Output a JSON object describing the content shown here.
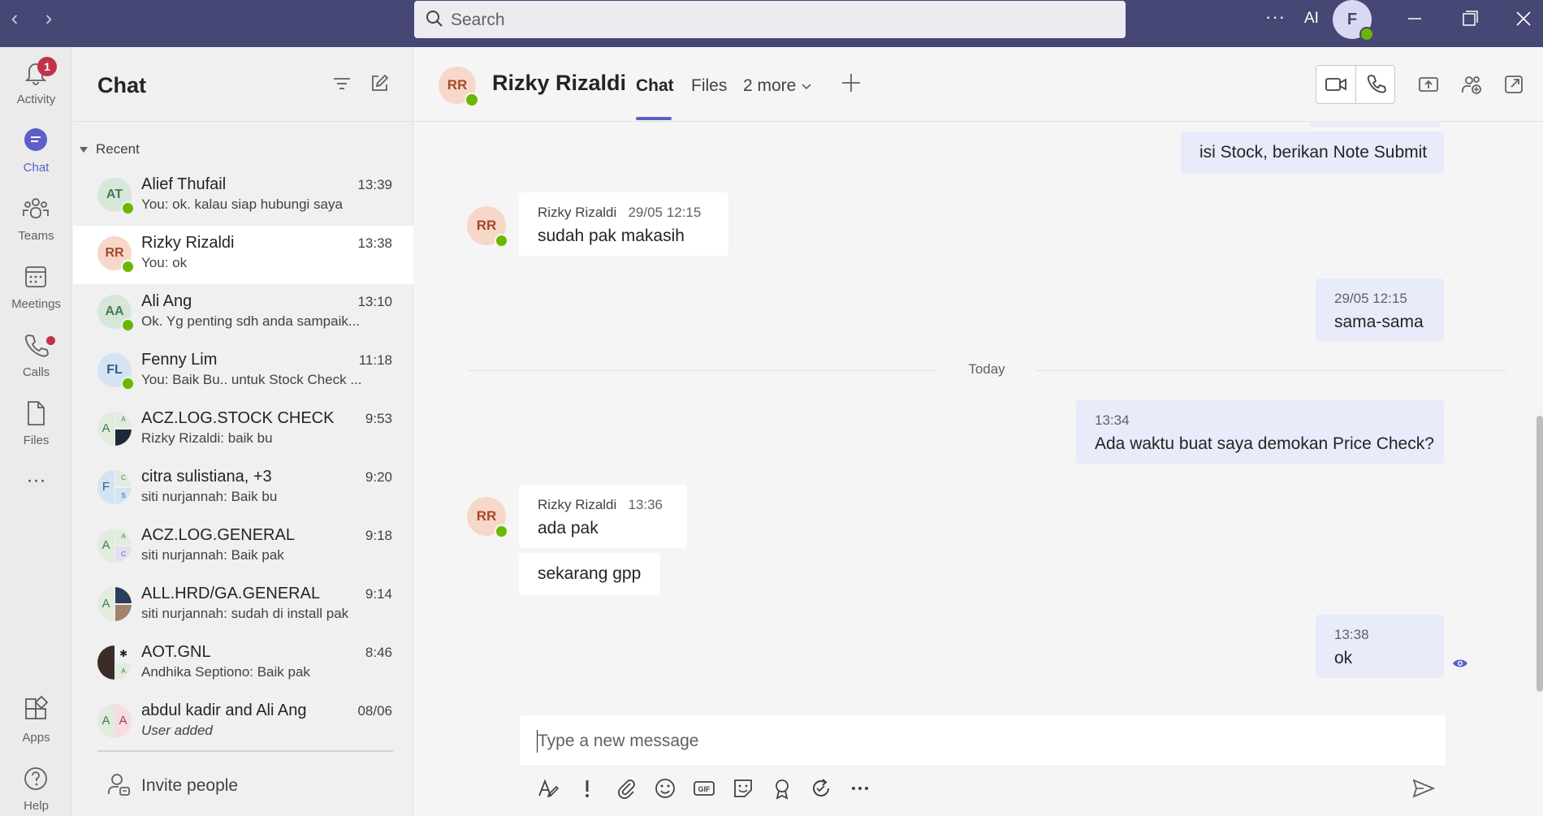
{
  "topbar": {
    "search_placeholder": "Search",
    "ai_label": "AI",
    "avatar_initial": "F"
  },
  "rail": {
    "items": [
      {
        "label": "Activity",
        "badge": "1"
      },
      {
        "label": "Chat"
      },
      {
        "label": "Teams"
      },
      {
        "label": "Meetings"
      },
      {
        "label": "Calls"
      },
      {
        "label": "Files"
      },
      {
        "label": "Apps"
      },
      {
        "label": "Help"
      }
    ]
  },
  "chatlist": {
    "title": "Chat",
    "section": "Recent",
    "items": [
      {
        "initials": "AT",
        "name": "Alief Thufail",
        "time": "13:39",
        "preview": "You: ok. kalau siap hubungi saya"
      },
      {
        "initials": "RR",
        "name": "Rizky Rizaldi",
        "time": "13:38",
        "preview": "You: ok"
      },
      {
        "initials": "AA",
        "name": "Ali Ang",
        "time": "13:10",
        "preview": "Ok. Yg penting sdh anda sampaik..."
      },
      {
        "initials": "FL",
        "name": "Fenny Lim",
        "time": "11:18",
        "preview": "You: Baik Bu.. untuk Stock Check ..."
      },
      {
        "initials": "A",
        "sub": [
          "A",
          ""
        ],
        "name": "ACZ.LOG.STOCK CHECK",
        "time": "9:53",
        "preview": "Rizky Rizaldi: baik bu"
      },
      {
        "initials": "F",
        "sub": [
          "C",
          "S"
        ],
        "name": "citra sulistiana, +3",
        "time": "9:20",
        "preview": "siti nurjannah: Baik bu"
      },
      {
        "initials": "A",
        "sub": [
          "A",
          "C"
        ],
        "name": "ACZ.LOG.GENERAL",
        "time": "9:18",
        "preview": "siti nurjannah: Baik pak"
      },
      {
        "initials": "A",
        "sub": [
          "",
          ""
        ],
        "name": "ALL.HRD/GA.GENERAL",
        "time": "9:14",
        "preview": "siti nurjannah: sudah di install pak"
      },
      {
        "initials": "",
        "sub": [
          "",
          "A"
        ],
        "name": "AOT.GNL",
        "time": "8:46",
        "preview": "Andhika Septiono: Baik pak"
      },
      {
        "initials": "A",
        "sub": [
          "A",
          ""
        ],
        "name": "abdul kadir and Ali Ang",
        "time": "08/06",
        "preview": "User added"
      }
    ],
    "invite_label": "Invite people"
  },
  "chat": {
    "initials": "RR",
    "name": "Rizky Rizaldi",
    "tabs": [
      "Chat",
      "Files",
      "2 more"
    ],
    "messages": {
      "m1_text": "isi Stock, berikan Note Submit",
      "m2_sender": "Rizky Rizaldi",
      "m2_time": "29/05 12:15",
      "m2_text": "sudah pak makasih",
      "m3_time": "29/05 12:15",
      "m3_text": "sama-sama",
      "divider": "Today",
      "m4_time": "13:34",
      "m4_text": "Ada waktu buat saya demokan Price Check?",
      "m5_sender": "Rizky Rizaldi",
      "m5_time": "13:36",
      "m5_text": "ada pak",
      "m6_text": "sekarang gpp",
      "m7_time": "13:38",
      "m7_text": "ok"
    },
    "compose_placeholder": "Type a new message"
  },
  "colors": {
    "topbar": "#464775",
    "accent": "#5b5fc7",
    "presence_available": "#6bb700",
    "badge": "#c4314b",
    "outgoing_bubble": "#e8ebfa"
  }
}
